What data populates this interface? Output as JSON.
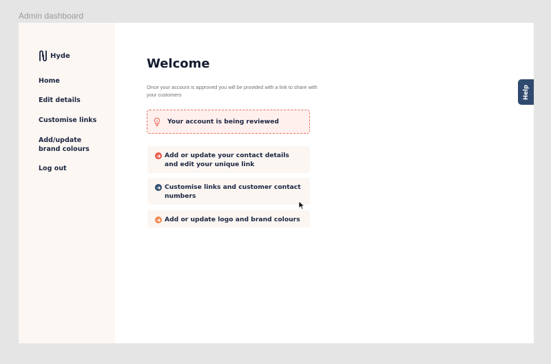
{
  "frame": {
    "label": "Admin dashboard"
  },
  "brand": {
    "name": "Hyde",
    "color": "#1b2540",
    "accent": "#e86d5d"
  },
  "sidebar": {
    "items": [
      {
        "label": "Home"
      },
      {
        "label": "Edit details"
      },
      {
        "label": "Customise links"
      },
      {
        "label": "Add/update brand colours"
      },
      {
        "label": "Log out"
      }
    ]
  },
  "main": {
    "title": "Welcome",
    "subtitle": "Once your account is approved you will be provided with a link to share with your customers",
    "status": {
      "icon": "lightbulb-icon",
      "text": "Your account is being reviewed"
    },
    "tasks": [
      {
        "icon": "arrow-right-circle-icon",
        "icon_color": "#ea5a48",
        "label": "Add or update your contact details and edit your unique link"
      },
      {
        "icon": "arrow-right-circle-icon",
        "icon_color": "#2f4a6e",
        "label": "Customise links and customer contact numbers"
      },
      {
        "icon": "arrow-right-circle-icon",
        "icon_color": "#f0894f",
        "label": "Add or update logo and brand colours"
      }
    ]
  },
  "help": {
    "label": "Help",
    "color": "#2f4a6e"
  }
}
